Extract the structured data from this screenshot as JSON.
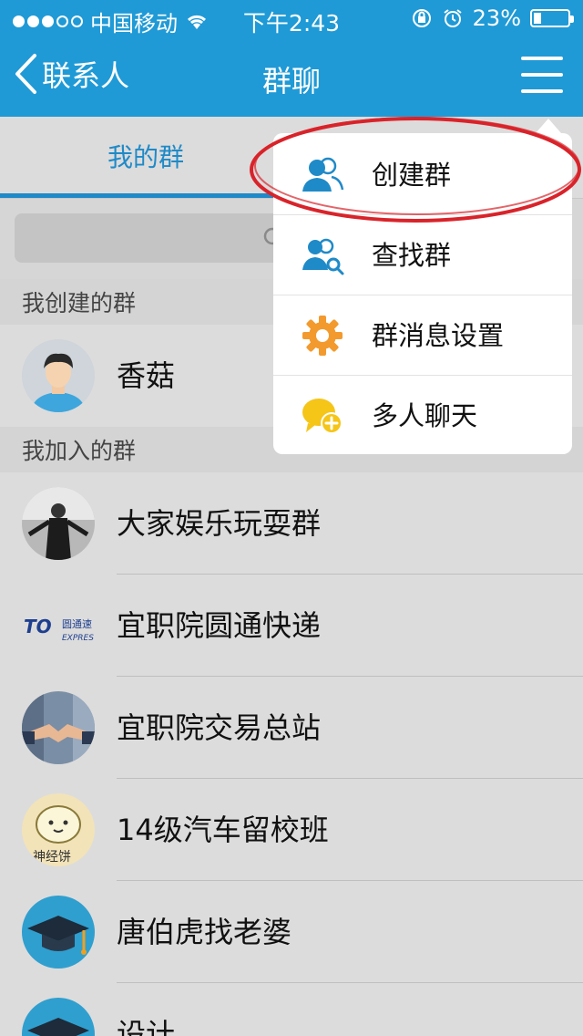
{
  "status_bar": {
    "carrier": "中国移动",
    "time": "下午2:43",
    "battery_pct": "23%",
    "battery_level": 0.23
  },
  "nav": {
    "back_label": "联系人",
    "title": "群聊"
  },
  "tabs": [
    {
      "label": "我的群",
      "active": true
    }
  ],
  "sections": {
    "created": "我创建的群",
    "joined": "我加入的群"
  },
  "created_groups": [
    {
      "name": "香菇",
      "avatar": "person-avatar-icon"
    }
  ],
  "joined_groups": [
    {
      "name": "大家娱乐玩耍群",
      "avatar": "photo-avatar"
    },
    {
      "name": "宜职院圆通快递",
      "avatar": "yto-logo",
      "logo_text": "圆通速",
      "logo_sub": "EXPRES"
    },
    {
      "name": "宜职院交易总站",
      "avatar": "handshake-avatar"
    },
    {
      "name": "14级汽车留校班",
      "avatar": "cartoon-avatar",
      "logo_text": "神经饼"
    },
    {
      "name": "唐伯虎找老婆",
      "avatar": "graduation-cap-icon"
    },
    {
      "name": "设计",
      "avatar": "graduation-cap-icon"
    }
  ],
  "popup_menu": [
    {
      "label": "创建群",
      "icon": "create-group-icon"
    },
    {
      "label": "查找群",
      "icon": "find-group-icon"
    },
    {
      "label": "群消息设置",
      "icon": "gear-icon"
    },
    {
      "label": "多人聊天",
      "icon": "multi-chat-icon"
    }
  ],
  "colors": {
    "accent": "#1f9ad6",
    "tab_active": "#1f8ac8",
    "highlight_circle": "#d9232a",
    "gear_orange": "#f39a2e",
    "chat_yellow": "#f5c518"
  }
}
